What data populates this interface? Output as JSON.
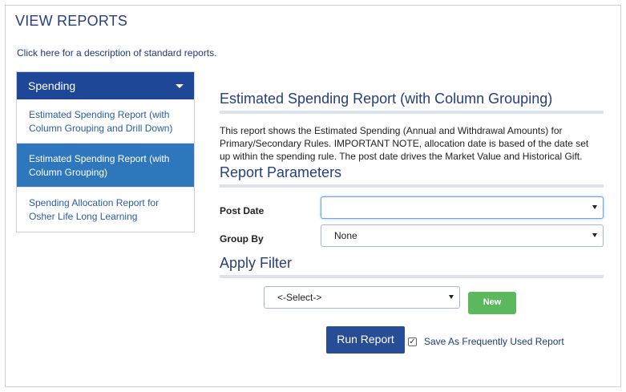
{
  "page": {
    "title": "VIEW REPORTS",
    "desc_prefix": "Click ",
    "desc_link": "here",
    "desc_suffix": " for a description of standard reports."
  },
  "nav": {
    "header": "Spending",
    "items": [
      {
        "label": "Estimated Spending Report (with Column Grouping and Drill Down)",
        "active": false
      },
      {
        "label": "Estimated Spending Report (with Column Grouping)",
        "active": true
      },
      {
        "label": "Spending Allocation Report for Osher Life Long Learning",
        "active": false
      }
    ]
  },
  "report": {
    "title": "Estimated Spending Report (with Column Grouping)",
    "description": "This report shows the Estimated Spending (Annual and Withdrawal Amounts) for Primary/Secondary Rules. IMPORTANT NOTE, allocation date is based of the date set up within the spending rule. The post date drives the Market Value and Historical Gift."
  },
  "parameters": {
    "heading": "Report Parameters",
    "post_date_label": "Post Date",
    "post_date_value": "",
    "group_by_label": "Group By",
    "group_by_value": "None"
  },
  "filter": {
    "heading": "Apply Filter",
    "select_value": "<-Select->",
    "new_label": "New"
  },
  "actions": {
    "run_label": "Run Report",
    "save_checked": true,
    "save_label": "Save As Frequently Used Report"
  },
  "colors": {
    "nav_header": "#1e4897",
    "nav_active": "#2e77bc",
    "run_button": "#284d97",
    "new_button": "#5cb85c"
  }
}
